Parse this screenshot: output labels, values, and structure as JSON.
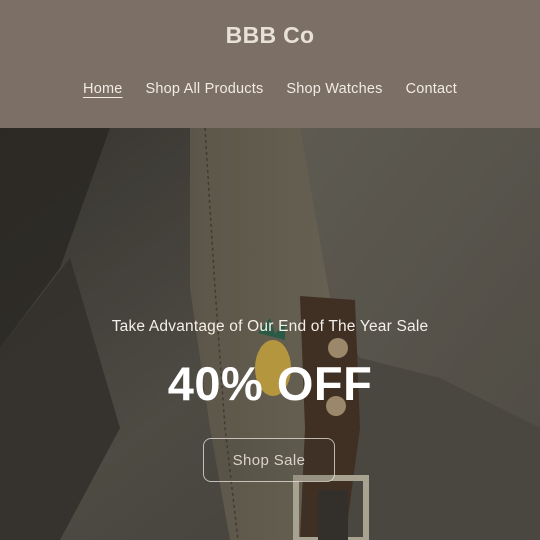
{
  "store": {
    "name": "BBB Co"
  },
  "nav": {
    "items": [
      {
        "label": "Home",
        "active": true
      },
      {
        "label": "Shop All Products",
        "active": false
      },
      {
        "label": "Shop Watches",
        "active": false
      },
      {
        "label": "Contact",
        "active": false
      }
    ]
  },
  "hero": {
    "kicker": "Take Advantage of Our End of The Year Sale",
    "headline": "40% OFF",
    "cta_label": "Shop Sale"
  },
  "colors": {
    "header_bg": "#7c6f66",
    "brand_text": "#e9e1d8"
  }
}
